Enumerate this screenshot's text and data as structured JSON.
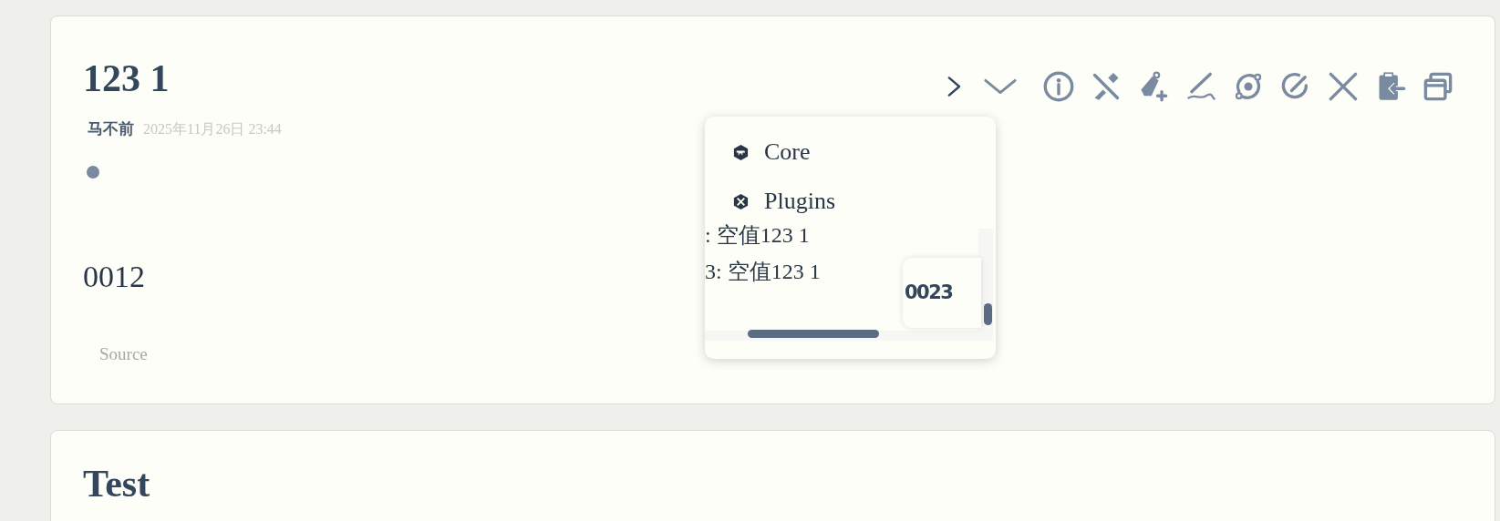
{
  "cards": [
    {
      "title": "123 1",
      "author": "马不前",
      "date": "2025年11月26日 23:44",
      "body": "0012",
      "source": "Source"
    },
    {
      "title": "Test"
    }
  ],
  "popup": {
    "menu": [
      {
        "label": "Core",
        "kind": "core"
      },
      {
        "label": "Plugins",
        "kind": "plugins"
      }
    ],
    "lines": [
      ": 空值123 1",
      "3: 空值123 1"
    ],
    "inner_card": "0023"
  }
}
